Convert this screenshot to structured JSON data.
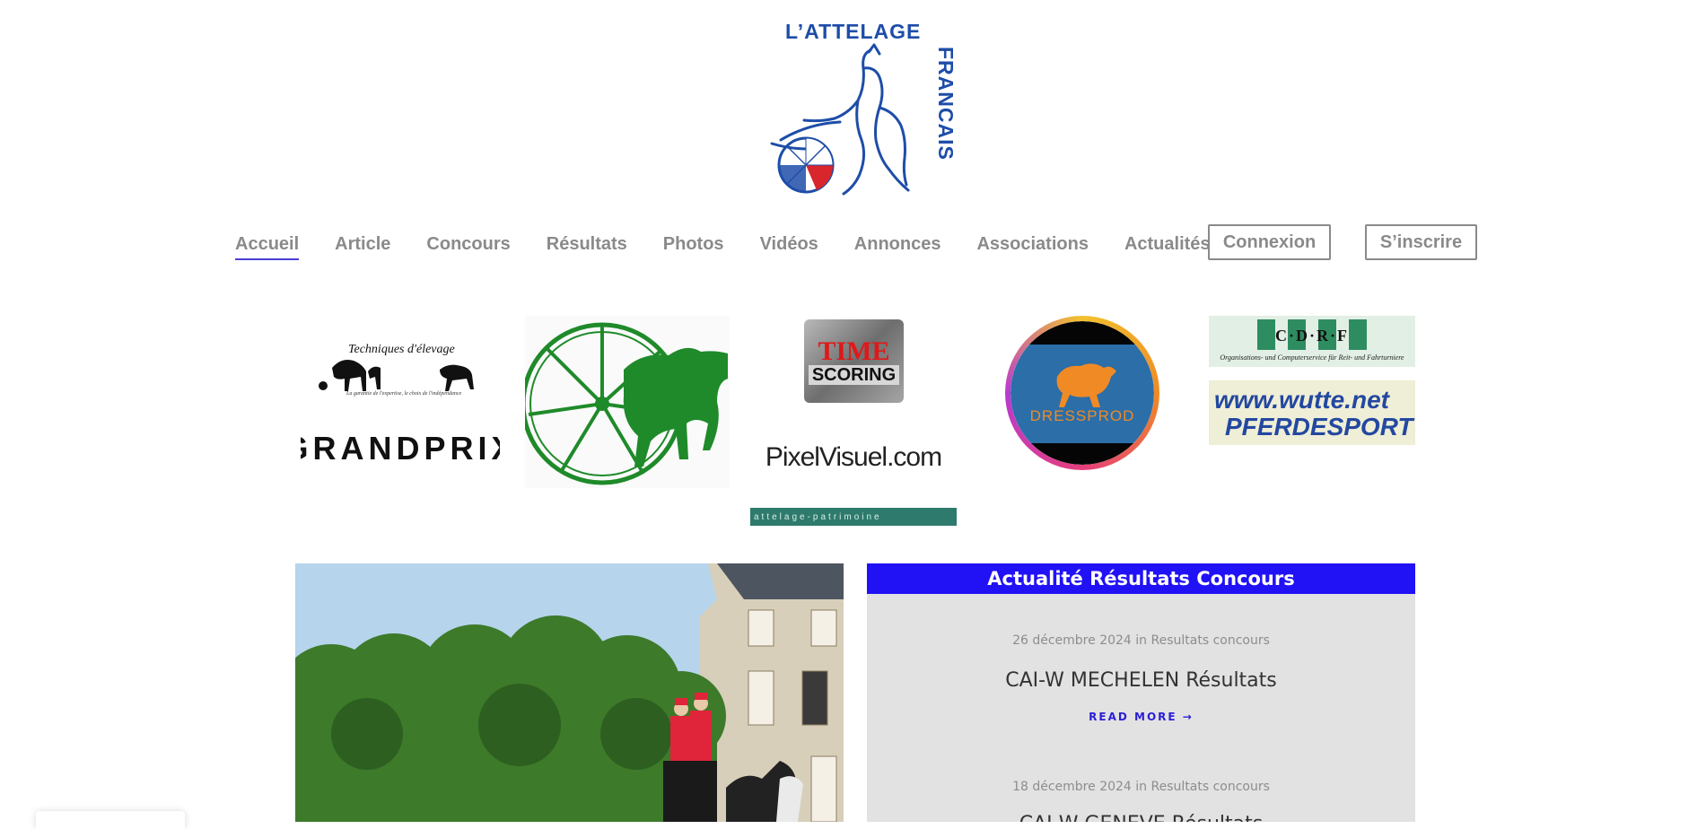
{
  "logo": {
    "text_top": "L’ATTELAGE",
    "text_side": "FRANCAIS",
    "colors": {
      "blue": "#1e4da8",
      "red": "#d9262c"
    }
  },
  "nav": {
    "items": [
      {
        "label": "Accueil",
        "active": true
      },
      {
        "label": "Article"
      },
      {
        "label": "Concours"
      },
      {
        "label": "Résultats"
      },
      {
        "label": "Photos"
      },
      {
        "label": "Vidéos"
      },
      {
        "label": "Annonces"
      },
      {
        "label": "Associations"
      },
      {
        "label": "Actualités"
      }
    ],
    "login": "Connexion",
    "signup": "S’inscrire",
    "active_underline_color": "#4b3fd6"
  },
  "sponsors": {
    "techniques": {
      "title": "Techniques d'élevage",
      "tagline": "La garantie de l'expertise, le choix de l'indépendance"
    },
    "grandprix": "GRANDPRIX",
    "time_scoring": {
      "line1": "TIME",
      "line2": "SCORING"
    },
    "pixelvisuel": "PixelVisuel.com",
    "patrimoine": "attelage-patrimoine",
    "dressprod": "DRESSPROD",
    "cdrf": {
      "label": "C·D·R·F",
      "sub": "Organisations- und Computerservice für Reit- und Fahrturniere"
    },
    "wutte": {
      "line1": "www.wutte.net",
      "line2": "PFERDESPORT"
    }
  },
  "news": {
    "heading": "Actualité Résultats Concours",
    "heading_bg": "#2112f5",
    "read_more": "READ MORE",
    "posts": [
      {
        "date": "26 décembre 2024",
        "sep": "in",
        "category": "Resultats concours",
        "title": "CAI-W MECHELEN Résultats"
      },
      {
        "date": "18 décembre 2024",
        "sep": "in",
        "category": "Resultats concours",
        "title": "CAI-W GENEVE Résultats"
      }
    ]
  }
}
